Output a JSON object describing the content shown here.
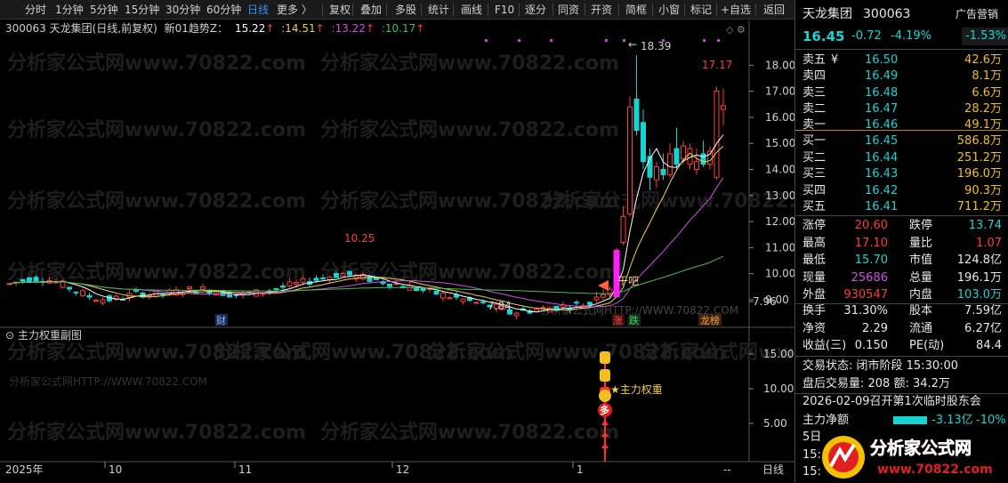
{
  "toolbar": {
    "items": [
      "分时",
      "1分钟",
      "5分钟",
      "15分钟",
      "30分钟",
      "60分钟",
      "日线",
      "更多 〉",
      "复权",
      "叠加",
      "多股",
      "统计",
      "画线",
      "F10",
      "逐分",
      "同资",
      "开资",
      "简框",
      "小窗",
      "标记",
      "+自选",
      "返回"
    ],
    "active": "日线"
  },
  "kline_header": {
    "code_name": "300063 天龙集团(日线,前复权)",
    "indicator": "新01趋势Z：",
    "v1": "15.22",
    "v2": "14.51",
    "v3": "13.22",
    "v4": "10.17",
    "arrow": "↑",
    "colors": {
      "v1": "#ffffff",
      "v2": "#f0d050",
      "v3": "#d050e0",
      "v4": "#40c040"
    }
  },
  "price_axis": [
    "18.00",
    "17.00",
    "16.00",
    "15.00",
    "14.00",
    "13.00",
    "12.00",
    "11.00",
    "10.00",
    "9.00",
    "7.96"
  ],
  "sub_axis": [
    "15.00",
    "10.00",
    "5.00"
  ],
  "annotations": {
    "high": "18.39",
    "peak2": "17.17",
    "mid_high": "10.25",
    "low": "7.84",
    "ganba": "干吧",
    "cai": "财",
    "zhang": "涨",
    "die": "跌",
    "longhu": "龙榜",
    "zhuli_label": "★主力权重",
    "duo": "多"
  },
  "sub_title": "主力权重副图",
  "watermarks": [
    "分析家公式网www.70822.com",
    "分析家公式网HTTP://WWW.70822.COM"
  ],
  "date_axis": [
    "2025年",
    "10",
    "11",
    "12",
    "1"
  ],
  "period_btn": "日线",
  "quote": {
    "name": "天龙集团",
    "code": "300063",
    "ad": "广告营销",
    "price": "16.45",
    "change": "-0.72",
    "pct": "-4.19%",
    "ad_pct": "-1.53%",
    "sells": [
      {
        "label": "卖五",
        "yen": "¥",
        "price": "16.50",
        "vol": "42.6万"
      },
      {
        "label": "卖四",
        "price": "16.49",
        "vol": "8.1万"
      },
      {
        "label": "卖三",
        "price": "16.48",
        "vol": "6.6万"
      },
      {
        "label": "卖二",
        "price": "16.47",
        "vol": "28.2万"
      },
      {
        "label": "卖一",
        "price": "16.46",
        "vol": "49.1万"
      }
    ],
    "buys": [
      {
        "label": "买一",
        "price": "16.45",
        "vol": "586.8万"
      },
      {
        "label": "买二",
        "price": "16.44",
        "vol": "251.2万"
      },
      {
        "label": "买三",
        "price": "16.43",
        "vol": "196.0万"
      },
      {
        "label": "买四",
        "price": "16.42",
        "vol": "90.3万"
      },
      {
        "label": "买五",
        "price": "16.41",
        "vol": "711.2万"
      }
    ],
    "stats": [
      [
        "涨停",
        "20.60",
        "跌停",
        "13.74"
      ],
      [
        "最高",
        "17.10",
        "量比",
        "1.07"
      ],
      [
        "最低",
        "15.70",
        "市值",
        "124.8亿"
      ],
      [
        "现量",
        "25686",
        "总量",
        "196.1万"
      ],
      [
        "外盘",
        "930547",
        "内盘",
        "103.0万"
      ]
    ],
    "stats2": [
      [
        "换手",
        "31.30%",
        "股本",
        "7.59亿"
      ],
      [
        "净资",
        "2.29",
        "流通",
        "6.27亿"
      ],
      [
        "收益(三)",
        "0.150",
        "PE(动)",
        "84.4"
      ]
    ],
    "trade_status": "交易状态: 闭市阶段 15:30:00",
    "after_hours": "盘后交易量: 208  额: 34.2万",
    "notice": "2026-02-09召开第1次临时股东会",
    "net_label": "主力净额",
    "net_val": "-3.13亿",
    "net_pct": "-10%",
    "row5": "5日",
    "t1": "15:",
    "t2": "15:"
  },
  "brand": {
    "name": "分析家公式网",
    "url": "www.70822.com"
  }
}
